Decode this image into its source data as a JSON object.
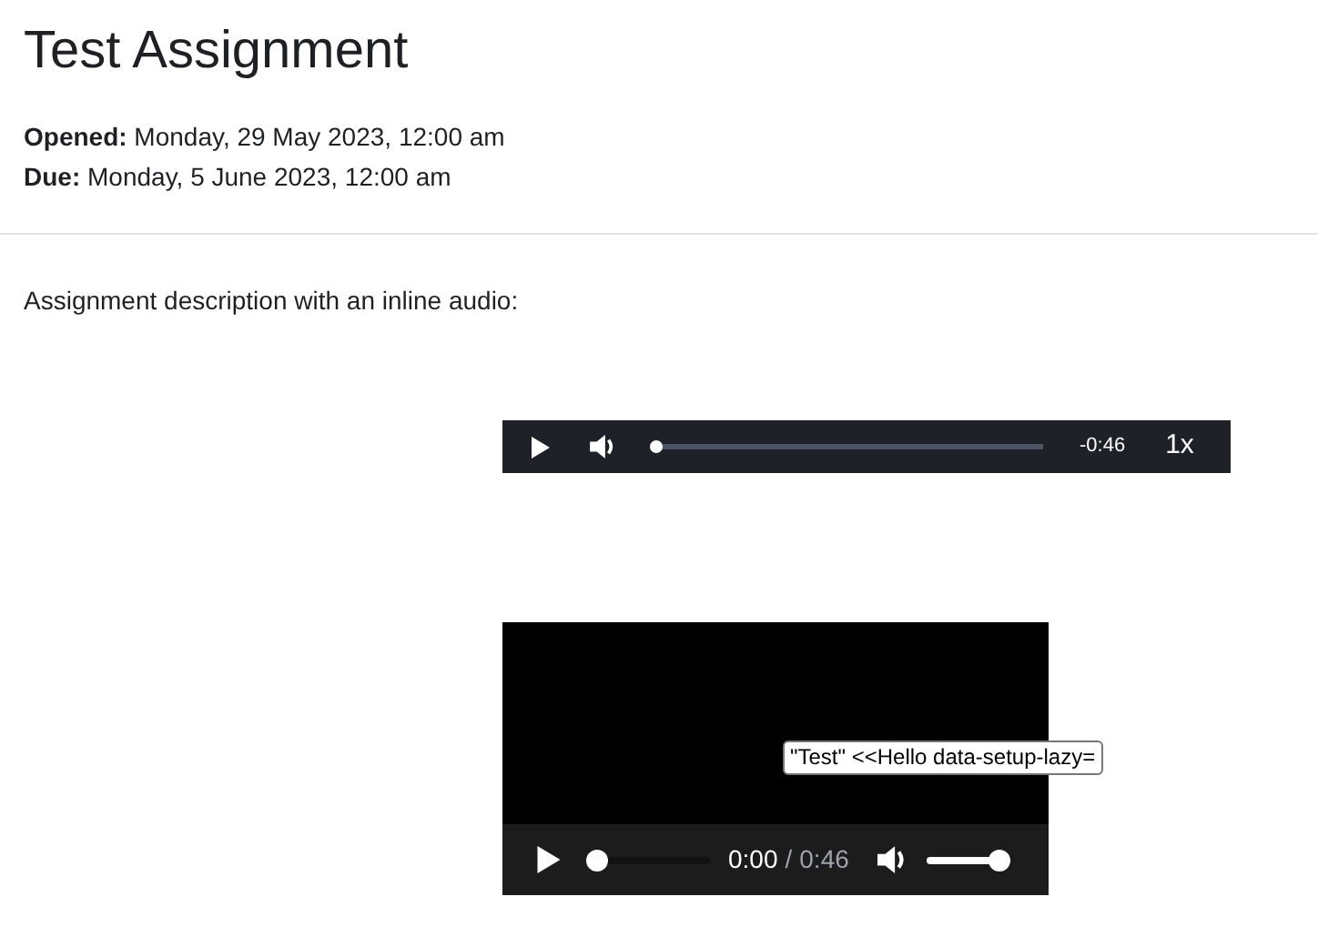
{
  "title": "Test Assignment",
  "dates": [
    {
      "label": "Opened:",
      "value": "Monday, 29 May 2023, 12:00 am"
    },
    {
      "label": "Due:",
      "value": "Monday, 5 June 2023, 12:00 am"
    }
  ],
  "description": "Assignment description with an inline audio:",
  "audio_player": {
    "progress": {
      "level": 0
    },
    "time_remaining": "-0:46",
    "speed": "1x"
  },
  "video_player": {
    "progress": {
      "level": 0
    },
    "current_time": "0:00",
    "separator": "/",
    "duration": "0:46",
    "volume": {
      "level": 1
    },
    "tooltip": "\"Test\" <<Hello data-setup-lazy="
  }
}
